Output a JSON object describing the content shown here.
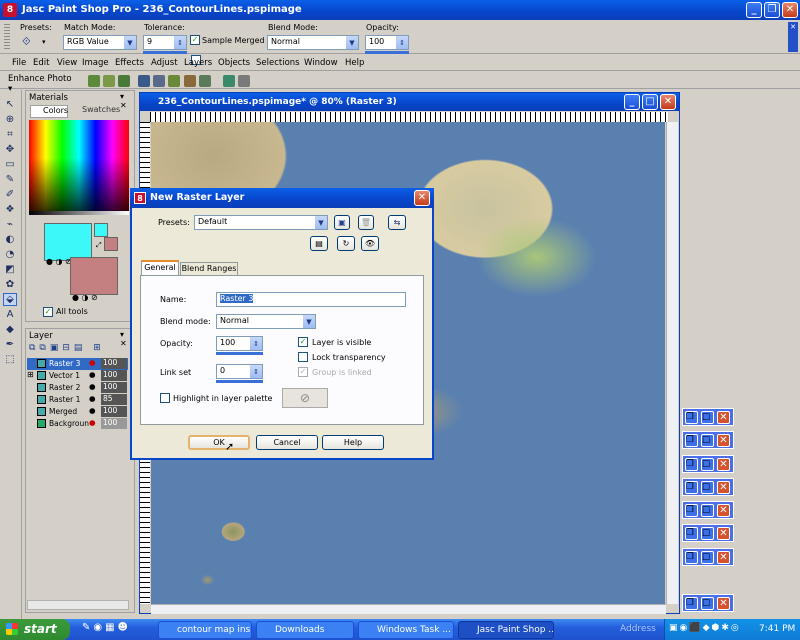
{
  "app": {
    "title": "Jasc Paint Shop Pro - 236_ContourLines.pspimage",
    "icon_letter": "8"
  },
  "tooloptions": {
    "presets_label": "Presets:",
    "match_mode_label": "Match Mode:",
    "match_mode_value": "RGB Value",
    "tolerance_label": "Tolerance:",
    "tolerance_value": "9",
    "sample_merged_label": "Sample Merged",
    "blend_mode_label": "Blend Mode:",
    "blend_mode_value": "Normal",
    "opacity_label": "Opacity:",
    "opacity_value": "100"
  },
  "menu": [
    "File",
    "Edit",
    "View",
    "Image",
    "Effects",
    "Adjust",
    "Layers",
    "Objects",
    "Selections",
    "Window",
    "Help"
  ],
  "photo_toolbar": {
    "enhance_label": "Enhance Photo"
  },
  "materials": {
    "title": "Materials",
    "tab_colors": "Colors",
    "tab_swatches": "Swatches",
    "all_tools": "All tools",
    "fg_color": "#3cf8f8",
    "bg_color": "#c48080"
  },
  "layers": {
    "title": "Layer",
    "rows": [
      {
        "name": "Raster 3",
        "opacity": "100"
      },
      {
        "name": "Vector 1",
        "opacity": "100"
      },
      {
        "name": "Raster 2",
        "opacity": "100"
      },
      {
        "name": "Raster 1",
        "opacity": "85"
      },
      {
        "name": "Merged",
        "opacity": "100"
      },
      {
        "name": "Backgroun",
        "opacity": "100"
      }
    ]
  },
  "document": {
    "title": "236_ContourLines.pspimage* @   80% (Raster 3)"
  },
  "dialog": {
    "title": "New Raster Layer",
    "presets_label": "Presets:",
    "presets_value": "Default",
    "tab_general": "General",
    "tab_blend": "Blend Ranges",
    "name_label": "Name:",
    "name_value": "Raster 3",
    "blend_label": "Blend mode:",
    "blend_value": "Normal",
    "opacity_label": "Opacity:",
    "opacity_value": "100",
    "linkset_label": "Link set",
    "linkset_value": "0",
    "layer_visible": "Layer is visible",
    "lock_transparency": "Lock transparency",
    "group_linked": "Group is linked",
    "highlight": "Highlight in layer palette",
    "ok": "OK",
    "cancel": "Cancel",
    "help": "Help"
  },
  "taskbar": {
    "start": "start",
    "items": [
      "contour map ins...",
      "Downloads",
      "Windows Task ...",
      "Jasc Paint Shop ..."
    ],
    "address": "Address",
    "clock": "7:41 PM"
  }
}
